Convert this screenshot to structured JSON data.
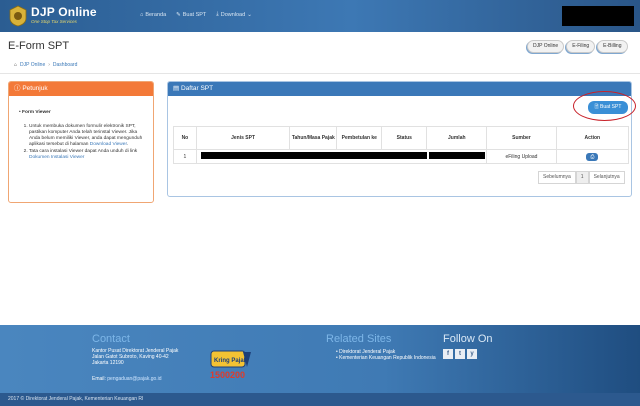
{
  "brand": {
    "title": "DJP Online",
    "subtitle": "One Stop Tax Services"
  },
  "nav": [
    {
      "icon": "home-icon",
      "glyph": "⌂",
      "label": "Beranda"
    },
    {
      "icon": "edit-icon",
      "glyph": "✎",
      "label": "Buat SPT"
    },
    {
      "icon": "download-icon",
      "glyph": "⤓",
      "label": "Download",
      "caret": "⌄"
    }
  ],
  "page": {
    "title": "E-Form SPT",
    "top_buttons": [
      "DJP Online",
      "E-Filing",
      "E-Billing"
    ],
    "breadcrumb": [
      "DJP Online",
      "Dashboard"
    ]
  },
  "petunjuk": {
    "title": "Petunjuk",
    "section": "Form Viewer",
    "items": [
      {
        "text": "Untuk membuka dokumen formulir elektronik SPT, pastikan komputer Anda telah terinstal Viewer. Jika Anda belum memiliki Viewer, anda dapat mengunduh aplikasi tersebut di halaman ",
        "link": "Download Viewer",
        "after": "."
      },
      {
        "text": "Tata cara instalasi Viewer dapat Anda unduh di link ",
        "link": "Dokumen Instalasi Viewer",
        "after": ""
      }
    ]
  },
  "daftar": {
    "title": "Daftar SPT",
    "buat_label": "Buat SPT",
    "columns": [
      "No",
      "Jenis SPT",
      "Tahun/Masa Pajak",
      "Pembetulan ke",
      "Status",
      "Jumlah",
      "Sumber",
      "Action"
    ],
    "rows": [
      {
        "no": "1",
        "sumber": "eFiling Upload"
      }
    ],
    "pager": {
      "prev": "Sebelumnya",
      "page": "1",
      "next": "Selanjutnya"
    }
  },
  "footer": {
    "contact_title": "Contact",
    "address": [
      "Kantor Pusat Direktorat Jenderal Pajak",
      "Jalan Gatot Subroto, Kaving 40-42",
      "Jakarta 12190"
    ],
    "email_label": "Email: ",
    "email": "pengaduan@pajak.go.id",
    "callcenter_label": "Kring Pajak",
    "callcenter_number": "1500200",
    "related_title": "Related Sites",
    "related": [
      "Direktorat Jenderal Pajak",
      "Kementerian Keuangan Republik Indonesia"
    ],
    "follow_title": "Follow On",
    "social": [
      "f",
      "t",
      "y"
    ],
    "copyright": "2017 © Direktorat Jenderal Pajak, Kementerian Keuangan RI"
  },
  "colors": {
    "nav_bg": "#2b5d92",
    "orange": "#f37938",
    "blue": "#3b78b8",
    "highlight": "#c8222a"
  }
}
